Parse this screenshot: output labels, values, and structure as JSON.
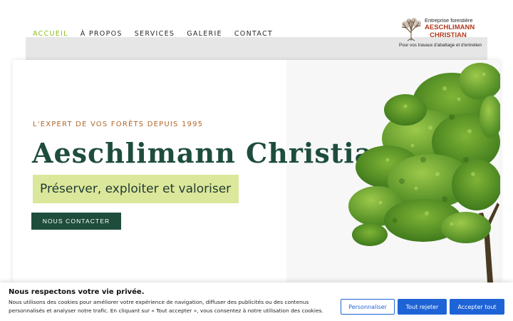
{
  "nav": {
    "items": [
      {
        "label": "ACCUEIL",
        "active": true
      },
      {
        "label": "À PROPOS",
        "active": false
      },
      {
        "label": "SERVICES",
        "active": false
      },
      {
        "label": "GALERIE",
        "active": false
      },
      {
        "label": "CONTACT",
        "active": false
      }
    ]
  },
  "logo": {
    "line1": "Entreprise forestière",
    "line2": "AESCHLIMANN",
    "line3": "CHRISTIAN",
    "tagline": "Pour vos travaux d'abattage et d'entretien"
  },
  "hero": {
    "eyebrow": "L'EXPERT DE VOS FORÊTS DEPUIS 1995",
    "title": "Aeschlimann Christian",
    "subtitle": "Préserver, exploiter et valoriser",
    "cta_label": "NOUS CONTACTER"
  },
  "cookie": {
    "title": "Nous respectons votre vie privée.",
    "text": "Nous utilisons des cookies pour améliorer votre expérience de navigation, diffuser des publicités ou des contenus personnalisés et analyser notre trafic. En cliquant sur « Tout accepter », vous consentez à notre utilisation des cookies.",
    "customize_label": "Personnaliser",
    "reject_label": "Tout rejeter",
    "accept_label": "Accepter tout"
  },
  "colors": {
    "accent": "#8cbd1a",
    "brand_dark_green": "#1e4d3c",
    "eyebrow_brown": "#b0672a",
    "subtitle_highlight": "#dbe79a",
    "cookie_blue": "#1e64d6",
    "logo_red": "#b23a1e"
  }
}
